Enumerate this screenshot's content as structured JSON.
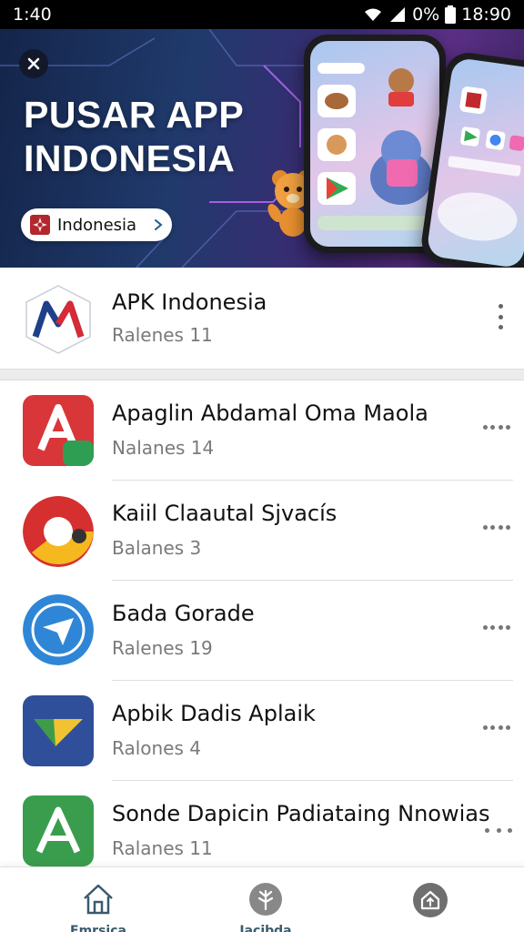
{
  "status_bar": {
    "time_left": "1:40",
    "battery_percent": "0%",
    "time_right": "18:90"
  },
  "banner": {
    "title_line1": "PUSAR APP",
    "title_line2": "INDONESIA",
    "region_label": "Indonesia"
  },
  "featured": {
    "title": "APK Indonesia",
    "subtitle": "Ralenes 11"
  },
  "apps": [
    {
      "title": "Apaglin Abdamal Oma Maola",
      "subtitle": "Nalanes 14",
      "icon": "red-a-app-icon"
    },
    {
      "title": "Kaiil Claautal Sjvacís",
      "subtitle": "Balanes 3",
      "icon": "red-yellow-ring-app-icon"
    },
    {
      "title": "Бada Gorade",
      "subtitle": "Ralenes 19",
      "icon": "blue-plane-app-icon"
    },
    {
      "title": "Apbik Dadis Aplaik",
      "subtitle": "Ralones 4",
      "icon": "green-arrow-app-icon"
    },
    {
      "title": "Sonde Dapicin Padiataing Nnowias",
      "subtitle": "Ralanes 11",
      "icon": "green-a-app-icon"
    }
  ],
  "bottom_nav": [
    {
      "label": "Fmrsica",
      "icon": "home-icon"
    },
    {
      "label": "Jacibda",
      "icon": "tree-icon"
    },
    {
      "label": "",
      "icon": "house-upload-icon"
    }
  ],
  "colors": {
    "status_bar": "#000000",
    "nav_teal": "#3a5a6e",
    "subtitle_gray": "#7a7a7a"
  }
}
